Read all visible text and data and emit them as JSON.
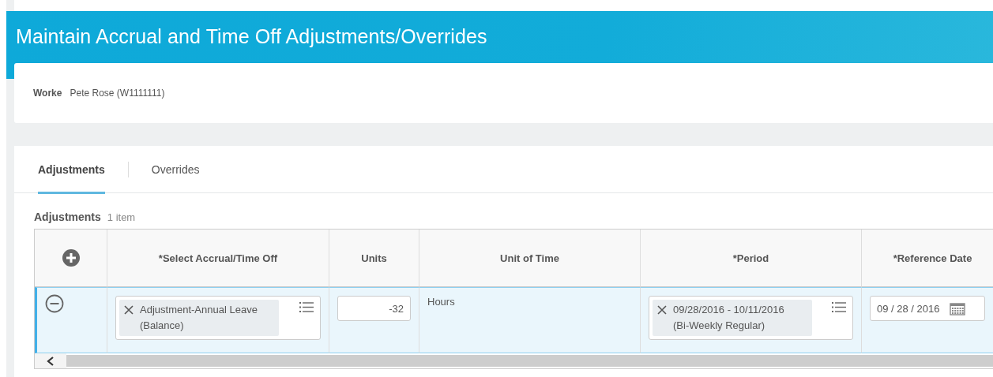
{
  "header": {
    "title": "Maintain Accrual and Time Off Adjustments/Overrides"
  },
  "worker": {
    "label": "Worke",
    "value": "Pete Rose (W1111111)"
  },
  "tabs": [
    {
      "label": "Adjustments",
      "selected": true
    },
    {
      "label": "Overrides",
      "selected": false
    }
  ],
  "grid": {
    "title": "Adjustments",
    "count": "1 item",
    "columns": [
      "*Select Accrual/Time Off",
      "Units",
      "Unit of Time",
      "*Period",
      "*Reference Date"
    ],
    "rows": [
      {
        "selected": true,
        "accrual": "Adjustment-Annual Leave (Balance)",
        "units": "-32",
        "unit_of_time": "Hours",
        "period": "09/28/2016 - 10/11/2016 (Bi-Weekly Regular)",
        "reference_date": "09 / 28 / 2016"
      }
    ]
  }
}
